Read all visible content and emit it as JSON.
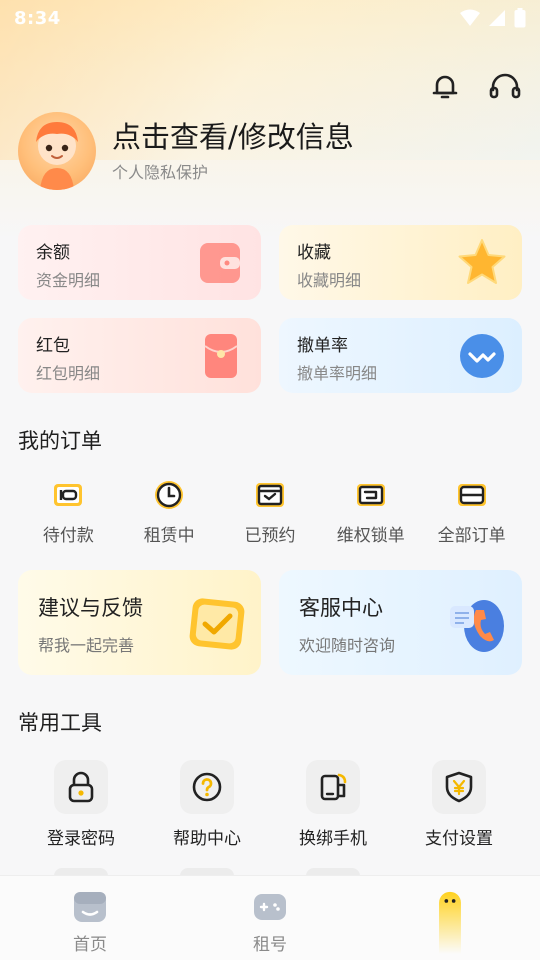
{
  "status_bar": {
    "time": "8:34"
  },
  "header": {
    "bell_icon": "bell-icon",
    "service_icon": "headset-icon"
  },
  "profile": {
    "title": "点击查看/修改信息",
    "subtitle": "个人隐私保护"
  },
  "cards": [
    {
      "title": "余额",
      "subtitle": "资金明细",
      "icon": "wallet-icon"
    },
    {
      "title": "收藏",
      "subtitle": "收藏明细",
      "icon": "star-icon"
    },
    {
      "title": "红包",
      "subtitle": "红包明细",
      "icon": "red-envelope-icon"
    },
    {
      "title": "撤单率",
      "subtitle": "撤单率明细",
      "icon": "chart-icon"
    }
  ],
  "orders": {
    "title": "我的订单",
    "items": [
      {
        "label": "待付款",
        "icon": "wallet-icon"
      },
      {
        "label": "租赁中",
        "icon": "clock-icon"
      },
      {
        "label": "已预约",
        "icon": "calendar-check-icon"
      },
      {
        "label": "维权锁单",
        "icon": "lock-order-icon"
      },
      {
        "label": "全部订单",
        "icon": "card-icon"
      }
    ]
  },
  "promo_cards": [
    {
      "title": "建议与反馈",
      "subtitle": "帮我一起完善",
      "icon": "checkbox-icon"
    },
    {
      "title": "客服中心",
      "subtitle": "欢迎随时咨询",
      "icon": "phone-service-icon"
    }
  ],
  "tools": {
    "title": "常用工具",
    "items": [
      {
        "label": "登录密码",
        "icon": "lock-icon"
      },
      {
        "label": "帮助中心",
        "icon": "help-icon"
      },
      {
        "label": "换绑手机",
        "icon": "phone-swap-icon"
      },
      {
        "label": "支付设置",
        "icon": "shield-yen-icon"
      }
    ]
  },
  "tabbar": [
    {
      "label": "首页",
      "icon": "home-icon"
    },
    {
      "label": "租号",
      "icon": "gamepad-icon"
    },
    {
      "label": "",
      "icon": "mascot-icon"
    }
  ],
  "colors": {
    "accent": "#f5b800",
    "text_primary": "#1f1f1f",
    "text_secondary": "#888888"
  }
}
